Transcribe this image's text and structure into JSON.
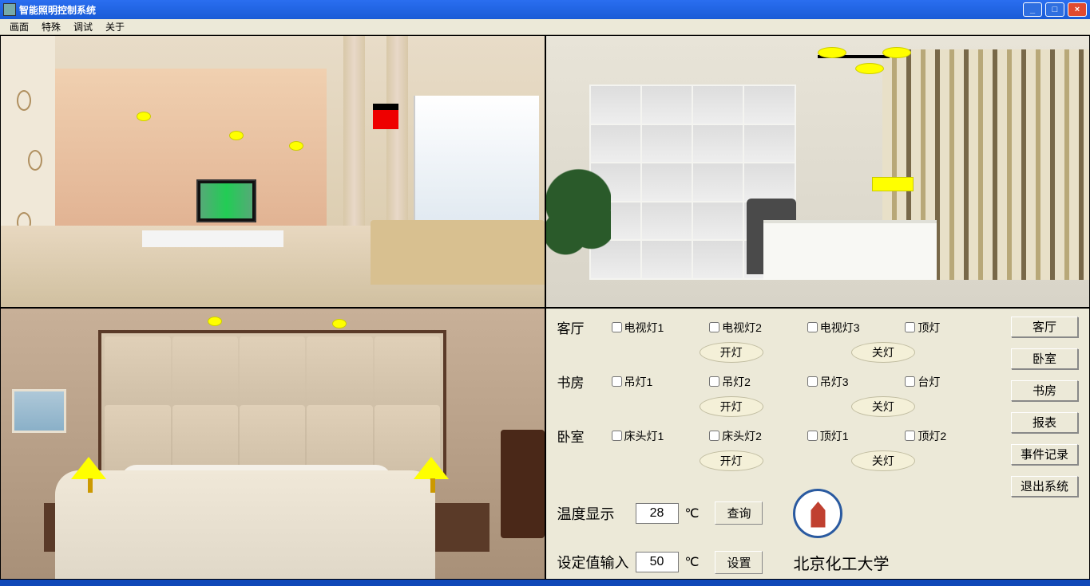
{
  "window": {
    "title": "智能照明控制系统"
  },
  "menu": {
    "items": [
      "画面",
      "特殊",
      "调试",
      "关于"
    ]
  },
  "rooms": {
    "living": {
      "label": "客厅",
      "checks": [
        "电视灯1",
        "电视灯2",
        "电视灯3",
        "顶灯"
      ],
      "on": "开灯",
      "off": "关灯"
    },
    "study": {
      "label": "书房",
      "checks": [
        "吊灯1",
        "吊灯2",
        "吊灯3",
        "台灯"
      ],
      "on": "开灯",
      "off": "关灯"
    },
    "bedroom": {
      "label": "卧室",
      "checks": [
        "床头灯1",
        "床头灯2",
        "顶灯1",
        "顶灯2"
      ],
      "on": "开灯",
      "off": "关灯"
    }
  },
  "temp": {
    "display_label": "温度显示",
    "display_value": "28",
    "unit": "℃",
    "query": "查询",
    "set_label": "设定值输入",
    "set_value": "50",
    "set_btn": "设置"
  },
  "university": "北京化工大学",
  "side_buttons": [
    "客厅",
    "卧室",
    "书房",
    "报表",
    "事件记录",
    "退出系统"
  ]
}
